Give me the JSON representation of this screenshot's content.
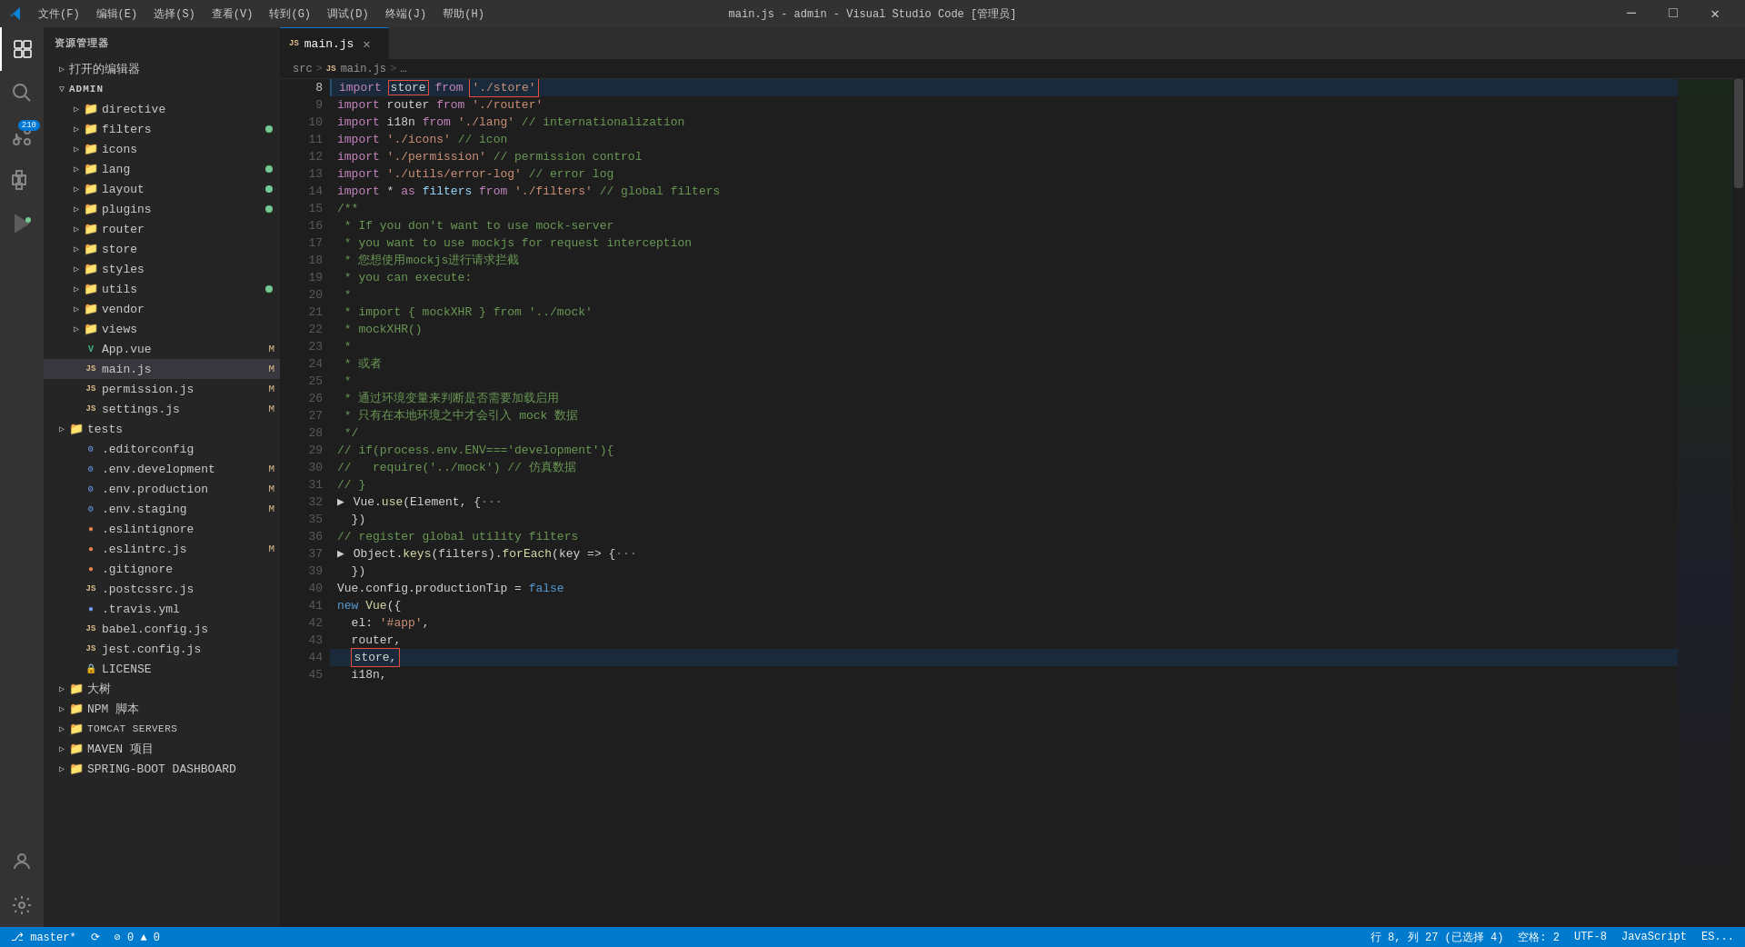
{
  "titlebar": {
    "title": "main.js - admin - Visual Studio Code [管理员]",
    "menus": [
      "文件(F)",
      "编辑(E)",
      "选择(S)",
      "查看(V)",
      "转到(G)",
      "调试(D)",
      "终端(J)",
      "帮助(H)"
    ],
    "controls": {
      "minimize": "─",
      "maximize": "□",
      "close": "✕"
    }
  },
  "sidebar": {
    "header": "资源管理器",
    "open_editors_label": "打开的编辑器",
    "admin_label": "ADMIN",
    "tree_items": [
      {
        "label": "directive",
        "type": "folder",
        "indent": 1,
        "collapsed": true
      },
      {
        "label": "filters",
        "type": "folder",
        "indent": 1,
        "collapsed": true,
        "dot_color": "#73c991"
      },
      {
        "label": "icons",
        "type": "folder",
        "indent": 1,
        "collapsed": true
      },
      {
        "label": "lang",
        "type": "folder",
        "indent": 1,
        "collapsed": true,
        "dot_color": "#73c991"
      },
      {
        "label": "layout",
        "type": "folder",
        "indent": 1,
        "collapsed": true,
        "dot_color": "#73c991"
      },
      {
        "label": "plugins",
        "type": "folder",
        "indent": 1,
        "collapsed": true,
        "dot_color": "#73c991"
      },
      {
        "label": "router",
        "type": "folder",
        "indent": 1,
        "collapsed": true
      },
      {
        "label": "store",
        "type": "folder",
        "indent": 1,
        "collapsed": true
      },
      {
        "label": "styles",
        "type": "folder",
        "indent": 1,
        "collapsed": true
      },
      {
        "label": "utils",
        "type": "folder",
        "indent": 1,
        "collapsed": true,
        "dot_color": "#73c991"
      },
      {
        "label": "vendor",
        "type": "folder",
        "indent": 1,
        "collapsed": true
      },
      {
        "label": "views",
        "type": "folder",
        "indent": 1,
        "collapsed": true
      },
      {
        "label": "App.vue",
        "type": "vue",
        "indent": 1,
        "badge": "M"
      },
      {
        "label": "main.js",
        "type": "js",
        "indent": 1,
        "badge": "M",
        "active": true
      },
      {
        "label": "permission.js",
        "type": "js",
        "indent": 1,
        "badge": "M"
      },
      {
        "label": "settings.js",
        "type": "js",
        "indent": 1,
        "badge": "M"
      },
      {
        "label": "tests",
        "type": "folder",
        "indent": 0,
        "collapsed": true
      },
      {
        "label": ".editorconfig",
        "type": "dot",
        "indent": 0
      },
      {
        "label": ".env.development",
        "type": "dot",
        "indent": 0,
        "badge": "M"
      },
      {
        "label": ".env.production",
        "type": "dot",
        "indent": 0,
        "badge": "M"
      },
      {
        "label": ".env.staging",
        "type": "dot",
        "indent": 0,
        "badge": "M"
      },
      {
        "label": ".eslintignore",
        "type": "dot",
        "indent": 0
      },
      {
        "label": ".eslintrc.js",
        "type": "dot",
        "indent": 0,
        "badge": "M"
      },
      {
        "label": ".gitignore",
        "type": "dot",
        "indent": 0
      },
      {
        "label": ".postcssrc.js",
        "type": "js",
        "indent": 0
      },
      {
        "label": ".travis.yml",
        "type": "dot",
        "indent": 0
      },
      {
        "label": "babel.config.js",
        "type": "js",
        "indent": 0
      },
      {
        "label": "jest.config.js",
        "type": "js",
        "indent": 0
      },
      {
        "label": "LICENSE",
        "type": "lock",
        "indent": 0
      },
      {
        "label": "大树",
        "type": "folder",
        "indent": 0,
        "collapsed": true
      },
      {
        "label": "NPM 脚本",
        "type": "folder",
        "indent": 0,
        "collapsed": true
      },
      {
        "label": "TOMCAT SERVERS",
        "type": "folder",
        "indent": 0,
        "collapsed": true
      },
      {
        "label": "MAVEN 项目",
        "type": "folder",
        "indent": 0,
        "collapsed": true
      },
      {
        "label": "SPRING-BOOT DASHBOARD",
        "type": "folder",
        "indent": 0,
        "collapsed": true
      }
    ]
  },
  "tab": {
    "filename": "main.js",
    "icon": "JS"
  },
  "breadcrumb": {
    "parts": [
      "src",
      ">",
      "JS main.js",
      ">",
      "..."
    ]
  },
  "code_lines": [
    {
      "num": 8,
      "content": "import store from './store'",
      "highlighted": true,
      "has_box": true,
      "box_text": "store",
      "box_start": 7,
      "box_end": 12
    },
    {
      "num": 9,
      "content": "import router from './router'"
    },
    {
      "num": 10,
      "content": "import i18n from './lang' // internationalization"
    },
    {
      "num": 11,
      "content": "import './icons' // icon"
    },
    {
      "num": 12,
      "content": "import './permission' // permission control"
    },
    {
      "num": 13,
      "content": "import './utils/error-log' // error log"
    },
    {
      "num": 14,
      "content": "import * as filters from './filters' // global filters"
    },
    {
      "num": 15,
      "content": "/**"
    },
    {
      "num": 16,
      "content": " * If you don't want to use mock-server"
    },
    {
      "num": 17,
      "content": " * you want to use mockjs for request interception"
    },
    {
      "num": 18,
      "content": " * 您想使用mockjs进行请求拦截"
    },
    {
      "num": 19,
      "content": " * you can execute:"
    },
    {
      "num": 20,
      "content": " *"
    },
    {
      "num": 21,
      "content": " * import { mockXHR } from '../mock'"
    },
    {
      "num": 22,
      "content": " * mockXHR()"
    },
    {
      "num": 23,
      "content": " *"
    },
    {
      "num": 24,
      "content": " * 或者"
    },
    {
      "num": 25,
      "content": " *"
    },
    {
      "num": 26,
      "content": " * 通过环境变量来判断是否需要加载启用"
    },
    {
      "num": 27,
      "content": " * 只有在本地环境之中才会引入 mock 数据"
    },
    {
      "num": 28,
      "content": " */"
    },
    {
      "num": 29,
      "content": "// if(process.env.ENV==='development'){"
    },
    {
      "num": 30,
      "content": "//   require('../mock') // 仿真数据"
    },
    {
      "num": 31,
      "content": "// }"
    },
    {
      "num": 32,
      "content": "> Vue.use(Element, {···",
      "collapsed": true
    },
    {
      "num": 35,
      "content": "  })"
    },
    {
      "num": 36,
      "content": "// register global utility filters"
    },
    {
      "num": 37,
      "content": "> Object.keys(filters).forEach(key => {···",
      "collapsed": true
    },
    {
      "num": 39,
      "content": "  })"
    },
    {
      "num": 40,
      "content": "Vue.config.productionTip = false"
    },
    {
      "num": 41,
      "content": "new Vue({"
    },
    {
      "num": 42,
      "content": "  el: '#app',"
    },
    {
      "num": 43,
      "content": "  router,"
    },
    {
      "num": 44,
      "content": "  store,",
      "highlighted2": true,
      "has_box2": true
    },
    {
      "num": 45,
      "content": "  i18n,"
    }
  ],
  "status_bar": {
    "left": [
      {
        "label": "⎇ master*"
      },
      {
        "label": "⟳"
      },
      {
        "label": "⊘ 0 ▲ 0"
      }
    ],
    "right": [
      {
        "label": "行 8, 列 27 (已选择 4)"
      },
      {
        "label": "空格: 2"
      },
      {
        "label": "UTF-8"
      },
      {
        "label": "JavaScript"
      },
      {
        "label": "ES..."
      }
    ]
  },
  "activity_icons": [
    {
      "name": "explorer",
      "icon": "⊞",
      "active": true
    },
    {
      "name": "search",
      "icon": "🔍"
    },
    {
      "name": "source-control",
      "icon": "⌥",
      "badge": "210"
    },
    {
      "name": "extensions",
      "icon": "⊕"
    },
    {
      "name": "run",
      "icon": "▷"
    },
    {
      "name": "settings",
      "icon": "⚙"
    },
    {
      "name": "accounts",
      "icon": "👤"
    }
  ]
}
